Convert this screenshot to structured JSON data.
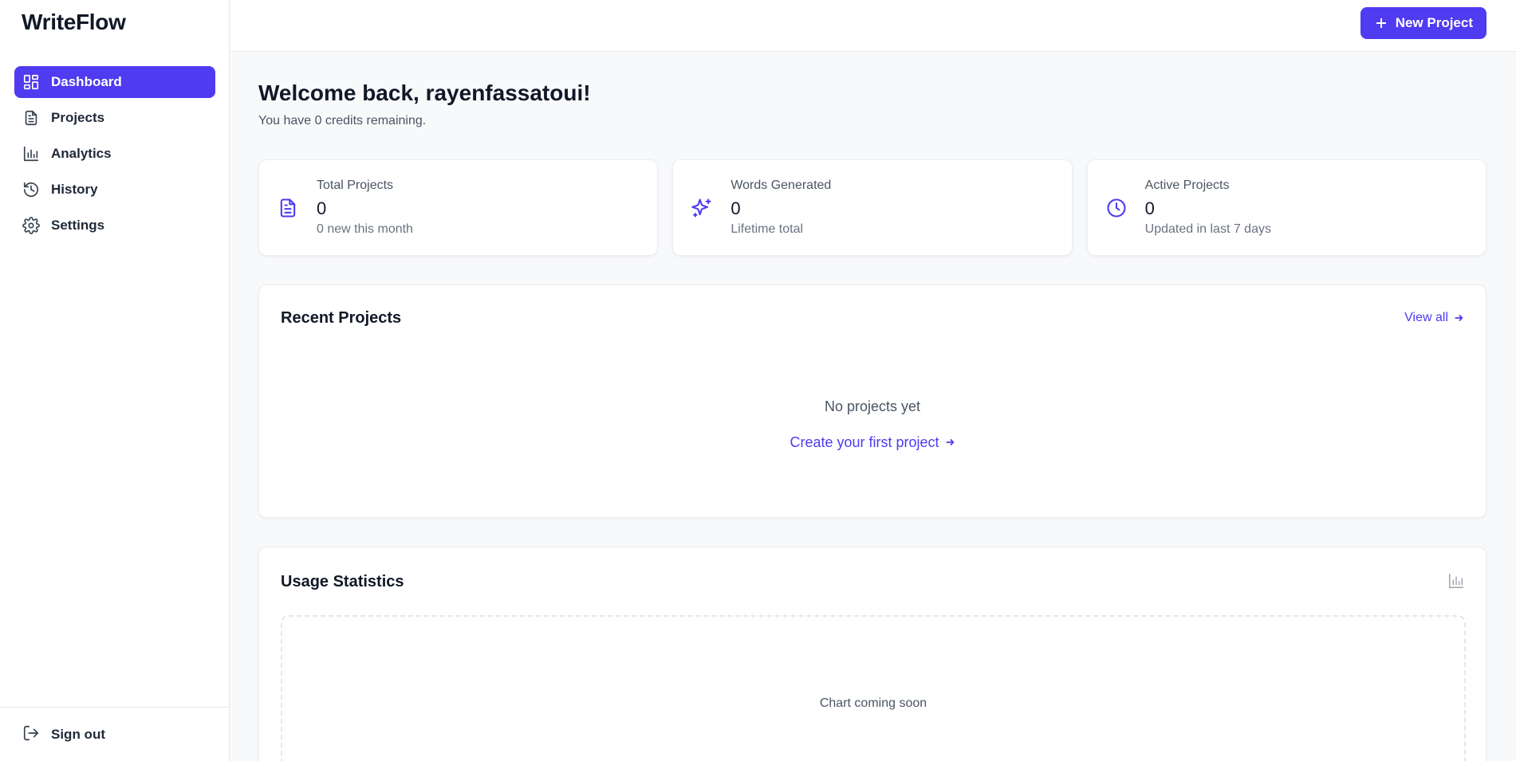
{
  "app": {
    "brand": "WriteFlow"
  },
  "sidebar": {
    "items": [
      {
        "label": "Dashboard",
        "icon": "dashboard-icon",
        "active": true
      },
      {
        "label": "Projects",
        "icon": "document-icon"
      },
      {
        "label": "Analytics",
        "icon": "bar-chart-icon"
      },
      {
        "label": "History",
        "icon": "history-icon"
      },
      {
        "label": "Settings",
        "icon": "gear-icon"
      }
    ],
    "signout_label": "Sign out"
  },
  "topbar": {
    "new_project_label": "New Project"
  },
  "main": {
    "welcome": "Welcome back, rayenfassatoui!",
    "credits": "You have 0 credits remaining.",
    "stats": [
      {
        "label": "Total Projects",
        "value": "0",
        "sub": "0 new this month",
        "icon": "document-icon"
      },
      {
        "label": "Words Generated",
        "value": "0",
        "sub": "Lifetime total",
        "icon": "sparkles-icon"
      },
      {
        "label": "Active Projects",
        "value": "0",
        "sub": "Updated in last 7 days",
        "icon": "clock-icon"
      }
    ],
    "recent": {
      "title": "Recent Projects",
      "view_all": "View all",
      "empty": "No projects yet",
      "create_link": "Create your first project"
    },
    "usage": {
      "title": "Usage Statistics",
      "placeholder": "Chart coming soon"
    }
  },
  "colors": {
    "accent": "#4f3bf0",
    "background": "#f8f9fb"
  }
}
